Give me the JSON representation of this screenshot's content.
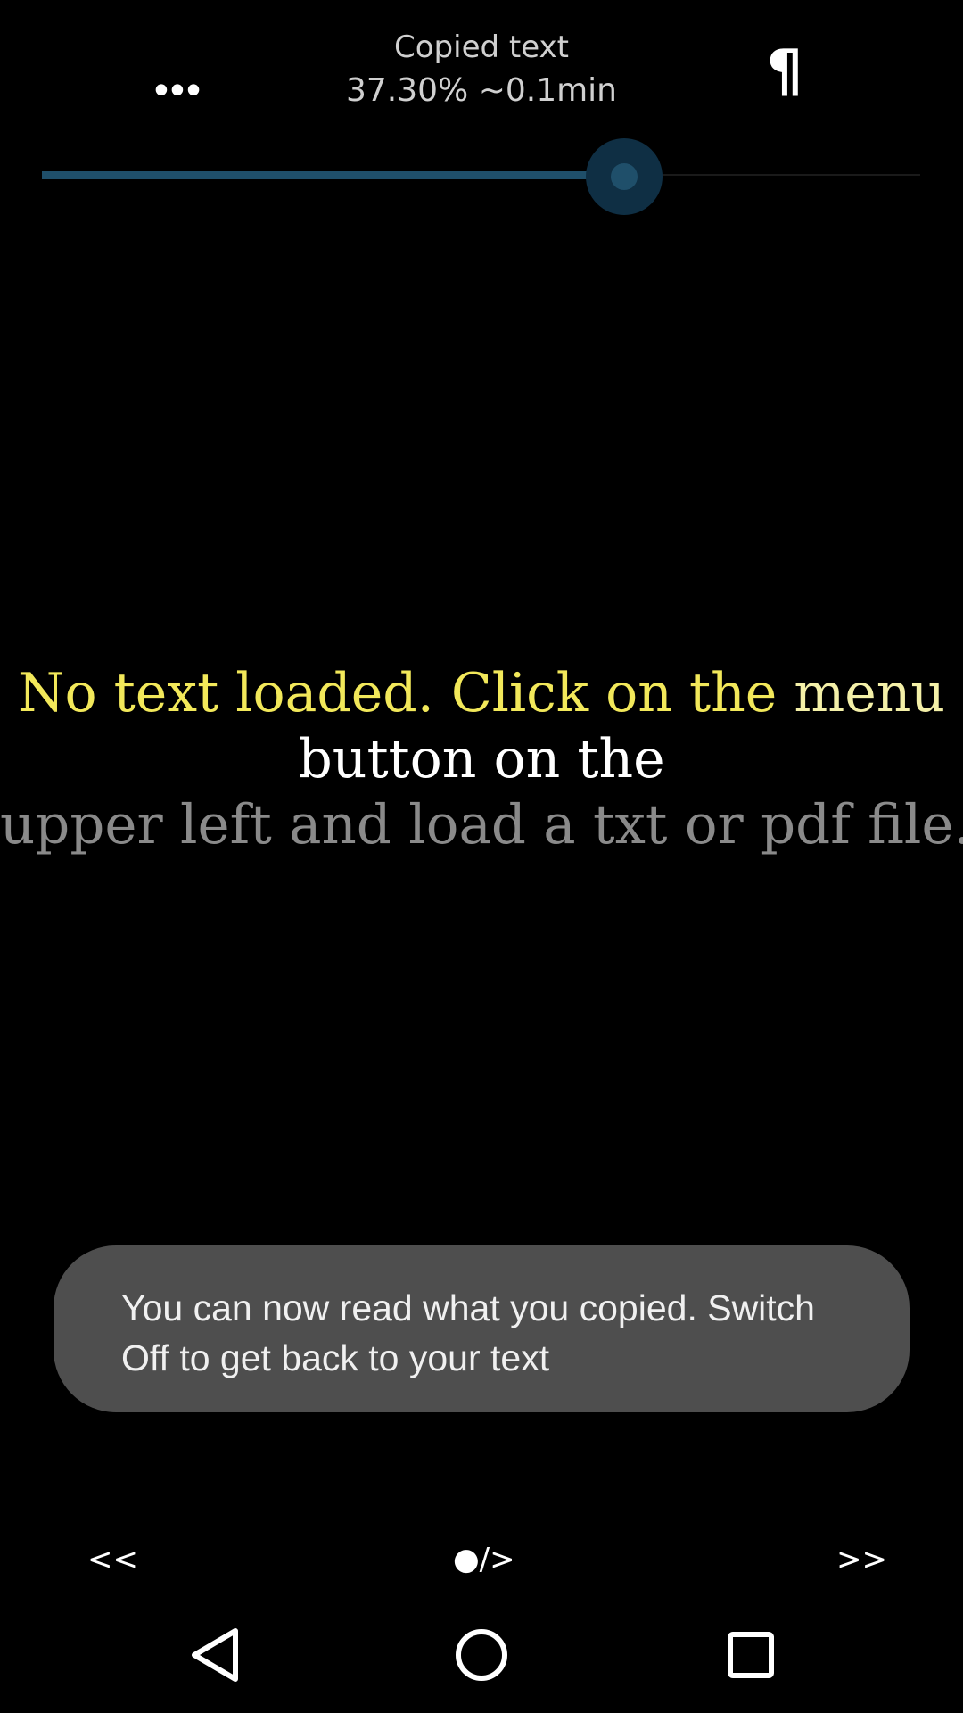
{
  "header": {
    "menu_label": "•••",
    "title": "Copied text",
    "progress_info": "37.30% ~0.1min",
    "paragraph_label": "¶"
  },
  "slider": {
    "value_percent": 37.3
  },
  "reading": {
    "line1_part1": "No text loaded. Click on the",
    "line1_part2": " menu",
    "line2": "button on the",
    "line3": "upper left and load a txt or pdf file."
  },
  "toast": {
    "message": "You can now read what you copied. Switch Off to get back to your text"
  },
  "controls": {
    "back_label": "<<",
    "play_label": "●/>",
    "forward_label": ">>"
  },
  "navbar": {
    "back_icon": "triangle-back-icon",
    "home_icon": "circle-home-icon",
    "recent_icon": "square-recents-icon"
  },
  "colors": {
    "background": "#000000",
    "accent": "#1f4f6a",
    "highlight": "#f2e85a",
    "dim_text": "#8a8a8a",
    "toast_bg": "#4e4e4e"
  }
}
